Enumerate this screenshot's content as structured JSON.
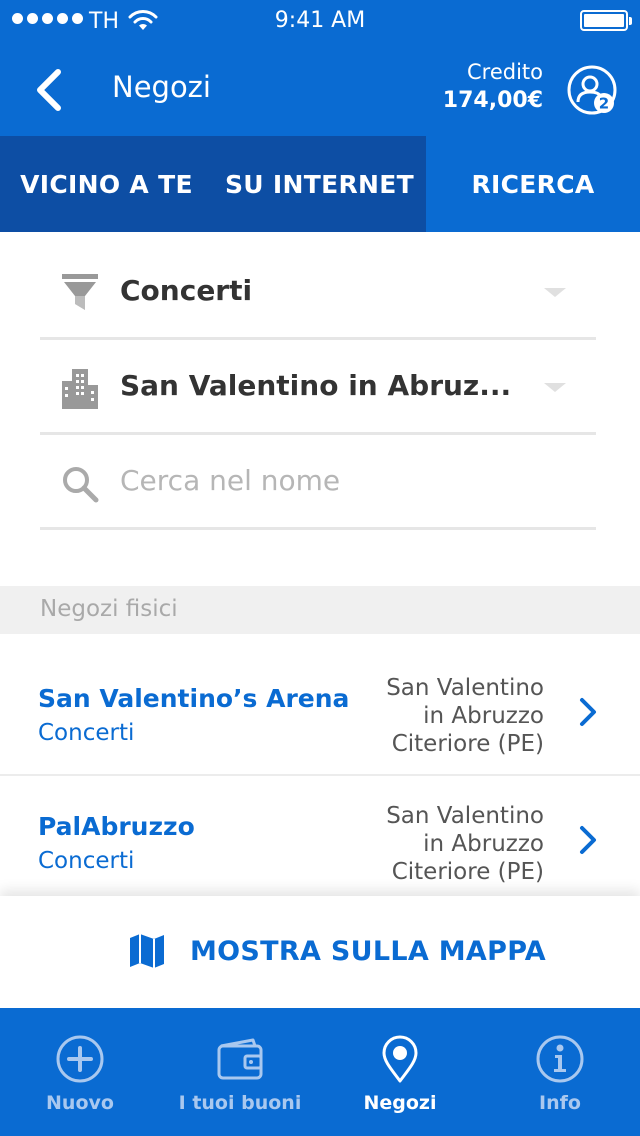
{
  "status_bar": {
    "carrier": "TH",
    "time": "9:41 AM"
  },
  "nav": {
    "title": "Negozi",
    "credit_label": "Credito",
    "credit_value": "174,00€",
    "profile_badge": "2"
  },
  "tabs": [
    {
      "label": "VICINO A TE",
      "active": false
    },
    {
      "label": "SU INTERNET",
      "active": false
    },
    {
      "label": "RICERCA",
      "active": true
    }
  ],
  "filters": {
    "category": "Concerti",
    "city": "San Valentino in Abruz...",
    "search_placeholder": "Cerca nel nome"
  },
  "section_title": "Negozi fisici",
  "stores": [
    {
      "name": "San Valentino’s Arena",
      "category": "Concerti",
      "location": [
        "San Valentino",
        "in Abruzzo",
        "Citeriore (PE)"
      ]
    },
    {
      "name": "PalAbruzzo",
      "category": "Concerti",
      "location": [
        "San Valentino",
        "in Abruzzo",
        "Citeriore (PE)"
      ]
    }
  ],
  "map_button": "MOSTRA SULLA MAPPA",
  "bottom_nav": [
    {
      "label": "Nuovo",
      "icon": "plus-circle-icon",
      "active": false
    },
    {
      "label": "I tuoi buoni",
      "icon": "wallet-icon",
      "active": false
    },
    {
      "label": "Negozi",
      "icon": "map-pin-icon",
      "active": true
    },
    {
      "label": "Info",
      "icon": "info-icon",
      "active": false
    }
  ],
  "colors": {
    "primary": "#0a6bd2",
    "tab_bar": "#0d4ea4",
    "inactive_nav": "#a9c8ef"
  }
}
